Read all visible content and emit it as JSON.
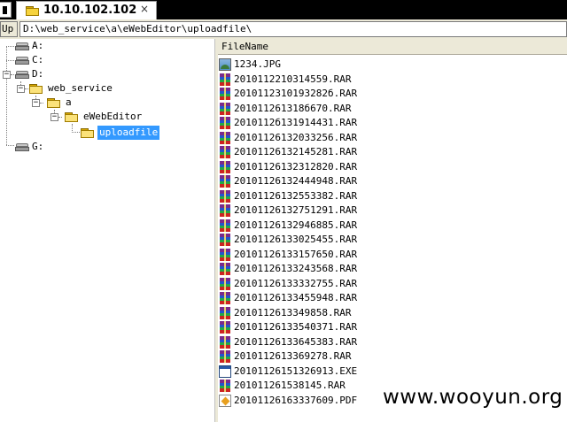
{
  "tab": {
    "title": "10.10.102.102",
    "close_label": "×"
  },
  "toolbar": {
    "up_label": "Up",
    "path": "D:\\web_service\\a\\eWebEditor\\uploadfile\\"
  },
  "tree": {
    "drives": [
      "A:",
      "C:",
      "D:",
      "G:"
    ],
    "folders": [
      "web_service",
      "a",
      "eWebEditor",
      "uploadfile"
    ]
  },
  "file_list": {
    "column_header": "FileName",
    "files": [
      {
        "name": "1234.JPG",
        "icon": "image-file-icon"
      },
      {
        "name": "2010112210314559.RAR",
        "icon": "rar-archive-icon"
      },
      {
        "name": "2010112310193282б.RAR",
        "icon": "rar-archive-icon"
      },
      {
        "name": "201011261318б670.RAR",
        "icon": "rar-archive-icon"
      },
      {
        "name": "2010112б131914431.RAR",
        "icon": "rar-archive-icon"
      },
      {
        "name": "20101126132033256.RAR",
        "icon": "rar-archive-icon"
      },
      {
        "name": "20101126132145281.RAR",
        "icon": "rar-archive-icon"
      },
      {
        "name": "20101126132312820.RAR",
        "icon": "rar-archive-icon"
      },
      {
        "name": "20101126132444948.RAR",
        "icon": "rar-archive-icon"
      },
      {
        "name": "20101126132553382.RAR",
        "icon": "rar-archive-icon"
      },
      {
        "name": "20101126132751291.RAR",
        "icon": "rar-archive-icon"
      },
      {
        "name": "20101126132946885.RAR",
        "icon": "rar-archive-icon"
      },
      {
        "name": "20101126133025455.RAR",
        "icon": "rar-archive-icon"
      },
      {
        "name": "20101126133157650.RAR",
        "icon": "rar-archive-icon"
      },
      {
        "name": "20101126133243568.RAR",
        "icon": "rar-archive-icon"
      },
      {
        "name": "20101126133332755.RAR",
        "icon": "rar-archive-icon"
      },
      {
        "name": "20101126133455948.RAR",
        "icon": "rar-archive-icon"
      },
      {
        "name": "2010112613349858.RAR",
        "icon": "rar-archive-icon"
      },
      {
        "name": "20101126133540371.RAR",
        "icon": "rar-archive-icon"
      },
      {
        "name": "20101126133645383.RAR",
        "icon": "rar-archive-icon"
      },
      {
        "name": "2010112613369278.RAR",
        "icon": "rar-archive-icon"
      },
      {
        "name": "20101126151326913.EXE",
        "icon": "exe-file-icon"
      },
      {
        "name": "201011261538145.RAR",
        "icon": "rar-archive-icon"
      },
      {
        "name": "20101126163337609.PDF",
        "icon": "pdf-file-icon"
      }
    ]
  },
  "watermark": "www.wooyun.org"
}
